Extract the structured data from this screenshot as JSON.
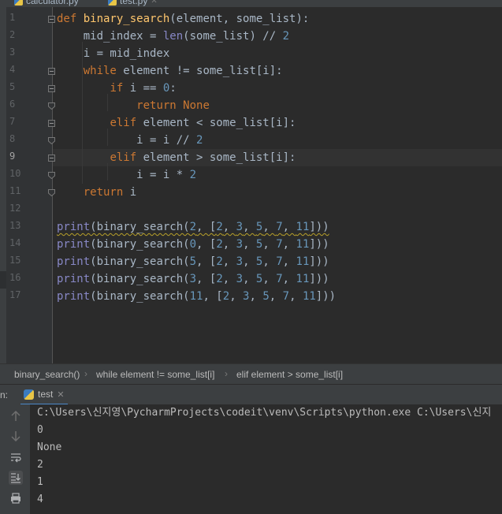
{
  "tabs": [
    {
      "label": "calculator.py",
      "icon": "python-file-icon",
      "active": false
    },
    {
      "label": "test.py",
      "icon": "python-file-icon",
      "active": true
    }
  ],
  "editor": {
    "current_line": 9,
    "line_numbers": [
      "1",
      "2",
      "3",
      "4",
      "5",
      "6",
      "7",
      "8",
      "9",
      "10",
      "11",
      "12",
      "13",
      "14",
      "15",
      "16",
      "17"
    ]
  },
  "breadcrumb": [
    "binary_search()",
    "while element != some_list[i]",
    "elif element > some_list[i]"
  ],
  "run_panel": {
    "label": "n:",
    "tab_label": "test",
    "output": [
      "C:\\Users\\신지영\\PycharmProjects\\codeit\\venv\\Scripts\\python.exe C:\\Users\\신지",
      "0",
      "None",
      "2",
      "1",
      "4"
    ]
  },
  "colors": {
    "keyword": "#cc7832",
    "function_name": "#ffc66d",
    "number": "#6897bb",
    "builtin": "#8888c6",
    "text": "#a9b7c6",
    "background": "#2b2b2b"
  }
}
